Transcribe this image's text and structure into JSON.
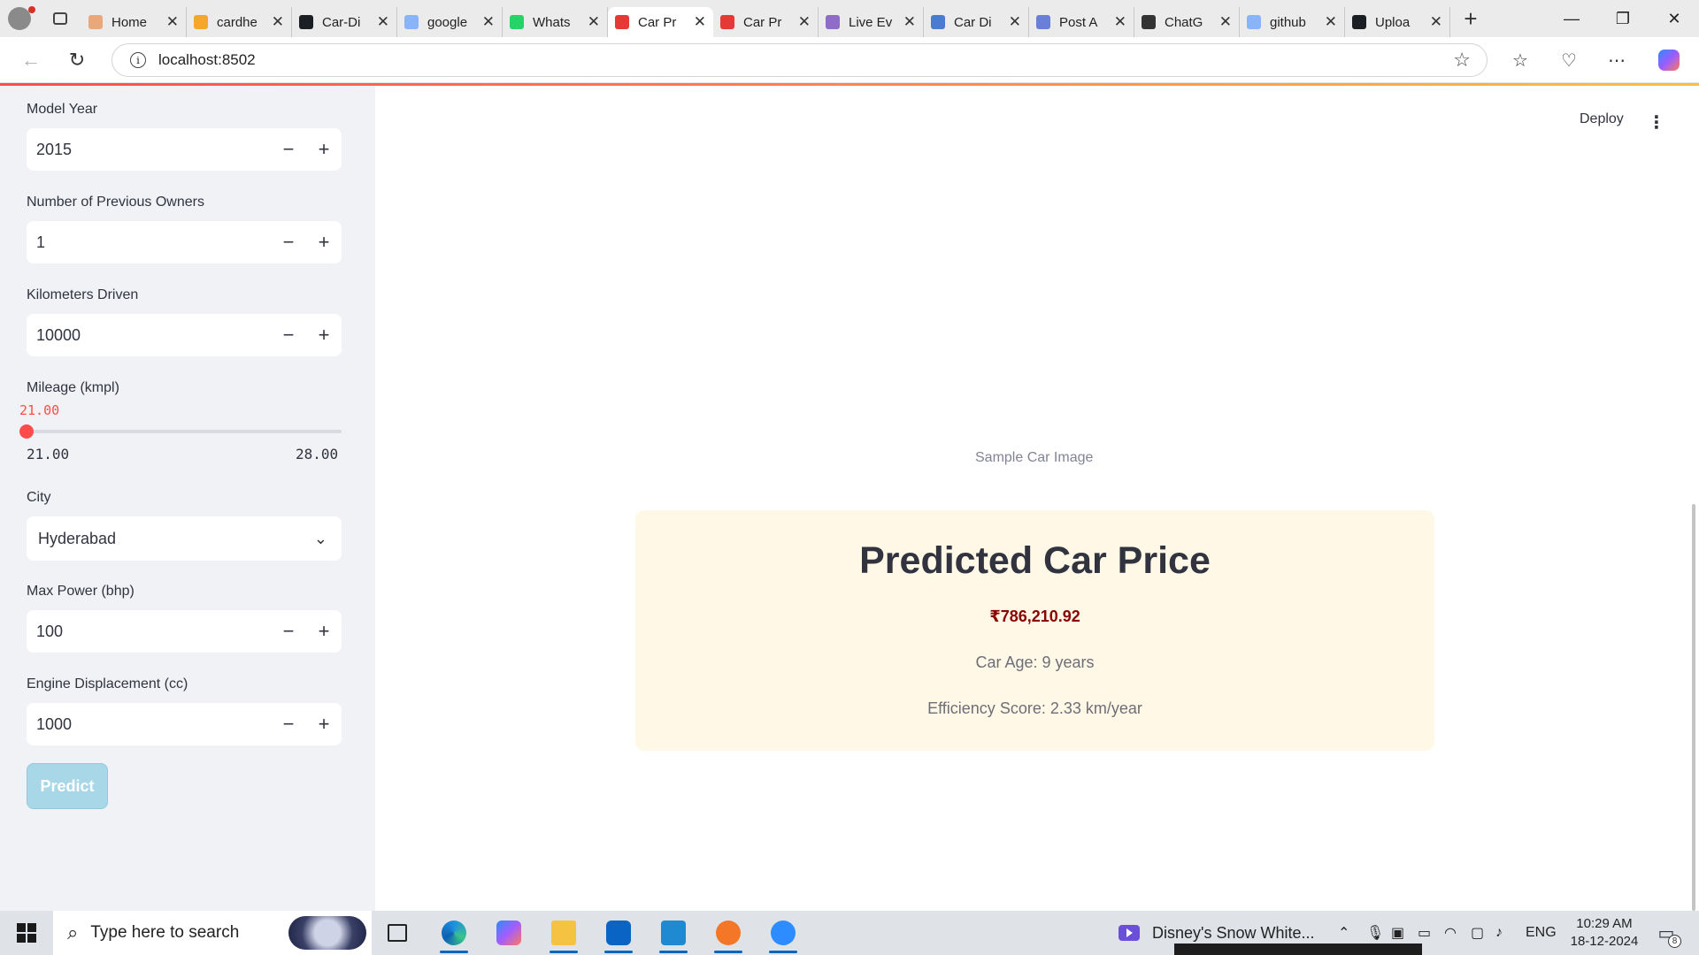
{
  "browser": {
    "tabs": [
      {
        "label": "Home",
        "icon": "loading-spinner-icon",
        "color": "#e8a87c"
      },
      {
        "label": "cardhe",
        "icon": "notebook-icon",
        "color": "#f4a72b"
      },
      {
        "label": "Car-Di",
        "icon": "github-icon",
        "color": "#1b1f23"
      },
      {
        "label": "google",
        "icon": "search-icon",
        "color": "#8ab4f8"
      },
      {
        "label": "Whats",
        "icon": "whatsapp-icon",
        "color": "#25d366"
      },
      {
        "label": "Car Pr",
        "icon": "car-icon",
        "color": "#e53935",
        "active": true
      },
      {
        "label": "Car Pr",
        "icon": "car-icon",
        "color": "#e53935"
      },
      {
        "label": "Live Ev",
        "icon": "list-icon",
        "color": "#8e6cc7"
      },
      {
        "label": "Car Di",
        "icon": "doc-icon",
        "color": "#4a7bd0"
      },
      {
        "label": "Post A",
        "icon": "zm-icon",
        "color": "#6a7fd8"
      },
      {
        "label": "ChatG",
        "icon": "openai-icon",
        "color": "#333333"
      },
      {
        "label": "github",
        "icon": "search-icon",
        "color": "#8ab4f8"
      },
      {
        "label": "Uploa",
        "icon": "github-icon",
        "color": "#1b1f23"
      }
    ],
    "url": "localhost:8502"
  },
  "sidebar": {
    "model_year": {
      "label": "Model Year",
      "value": "2015"
    },
    "owners": {
      "label": "Number of Previous Owners",
      "value": "1"
    },
    "km": {
      "label": "Kilometers Driven",
      "value": "10000"
    },
    "mileage": {
      "label": "Mileage (kmpl)",
      "current": "21.00",
      "min": "21.00",
      "max": "28.00",
      "fraction": 0
    },
    "city": {
      "label": "City",
      "value": "Hyderabad"
    },
    "power": {
      "label": "Max Power (bhp)",
      "value": "100"
    },
    "engine": {
      "label": "Engine Displacement (cc)",
      "value": "1000"
    },
    "predict_label": "Predict",
    "minus": "−",
    "plus": "+"
  },
  "header": {
    "deploy": "Deploy",
    "menu": "⋮"
  },
  "main": {
    "image_caption": "Sample Car Image",
    "result": {
      "title": "Predicted Car Price",
      "price": "₹786,210.92",
      "age": "Car Age: 9 years",
      "efficiency": "Efficiency Score: 2.33 km/year"
    }
  },
  "taskbar": {
    "search_placeholder": "Type here to search",
    "media_title": "Disney's Snow White...",
    "language": "ENG",
    "time": "10:29 AM",
    "date": "18-12-2024",
    "notification_count": "8"
  },
  "colors": {
    "accent": "#ff4b4b",
    "result_bg": "#fff8e7",
    "price": "#8b0000",
    "sidebar_bg": "#f0f2f6"
  }
}
